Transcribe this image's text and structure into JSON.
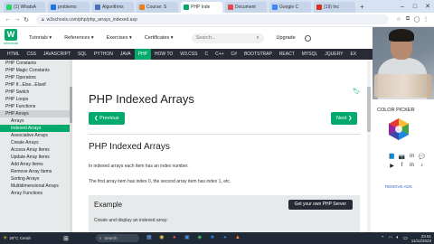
{
  "browser": {
    "tabs": [
      {
        "label": "(1) WhatsA",
        "color": "#25d366"
      },
      {
        "label": "problems",
        "color": "#1a73e8"
      },
      {
        "label": "Algorithms",
        "color": "#4b6fbf"
      },
      {
        "label": "Course: S",
        "color": "#e67e22"
      },
      {
        "label": "PHP Inde",
        "color": "#04aa6d",
        "active": true
      },
      {
        "label": "Document",
        "color": "#e14b4b"
      },
      {
        "label": "Google C",
        "color": "#4285f4"
      },
      {
        "label": "(19) Inc",
        "color": "#d93025"
      }
    ],
    "newtab": "+",
    "url": "w3schools.com/php/php_arrays_indexed.asp",
    "win_min": "–",
    "win_max": "□",
    "win_close": "✕"
  },
  "header": {
    "logo_letter": "W",
    "logo_text": "w3schools",
    "menu": [
      "Tutorials ▾",
      "References ▾",
      "Exercises ▾",
      "Certificates ▾"
    ],
    "search_placeholder": "Search...",
    "upgrade": "Upgrade"
  },
  "langnav": {
    "items": [
      "HTML",
      "CSS",
      "JAVASCRIPT",
      "SQL",
      "PYTHON",
      "JAVA",
      "PHP",
      "HOW TO",
      "W3.CSS",
      "C",
      "C++",
      "C#",
      "BOOTSTRAP",
      "REACT",
      "MYSQL",
      "JQUERY",
      "EX"
    ],
    "active_index": 6
  },
  "sidebar": {
    "items": [
      {
        "label": "PHP Constants",
        "kind": "item"
      },
      {
        "label": "PHP Magic Constants",
        "kind": "item"
      },
      {
        "label": "PHP Operators",
        "kind": "item"
      },
      {
        "label": "PHP If...Else...Elseif",
        "kind": "item"
      },
      {
        "label": "PHP Switch",
        "kind": "item"
      },
      {
        "label": "PHP Loops",
        "kind": "item"
      },
      {
        "label": "PHP Functions",
        "kind": "item"
      },
      {
        "label": "PHP Arrays",
        "kind": "head"
      },
      {
        "label": "Arrays",
        "kind": "sub"
      },
      {
        "label": "Indexed Arrays",
        "kind": "active"
      },
      {
        "label": "Associative Arrays",
        "kind": "sub"
      },
      {
        "label": "Create Arrays",
        "kind": "sub"
      },
      {
        "label": "Access Array Items",
        "kind": "sub"
      },
      {
        "label": "Update Array Items",
        "kind": "sub"
      },
      {
        "label": "Add Array Items",
        "kind": "sub"
      },
      {
        "label": "Remove Array Items",
        "kind": "sub"
      },
      {
        "label": "Sorting Arrays",
        "kind": "sub"
      },
      {
        "label": "Multidimensional Arrays",
        "kind": "sub"
      },
      {
        "label": "Array Functions",
        "kind": "sub"
      }
    ]
  },
  "main": {
    "title": "PHP Indexed Arrays",
    "prev": "❮ Previous",
    "next": "Next ❯",
    "section_title": "PHP Indexed Arrays",
    "para1": "In indexed arrays each item has an index number.",
    "para2": "The first array item has index 0, the second array item has index 1, etc.",
    "example_title": "Example",
    "example_desc": "Create and display an indexed array:",
    "get_server": "Get your own PHP Server"
  },
  "right": {
    "color_picker": "COLOR PICKER",
    "social": [
      "📘",
      "📷",
      "in",
      "💬",
      "▶",
      "f",
      "in",
      "♪"
    ],
    "remove_ads": "REMOVE ADS"
  },
  "taskbar": {
    "weather_temp": "29°C",
    "weather_desc": "Cerah",
    "search": "Search",
    "apps": [
      {
        "glyph": "▦",
        "color": "#6aa3f0"
      },
      {
        "glyph": "◉",
        "color": "#f2c94c"
      },
      {
        "glyph": "●",
        "color": "#e55353"
      },
      {
        "glyph": "▣",
        "color": "#4a90e2"
      },
      {
        "glyph": "◆",
        "color": "#34a853"
      },
      {
        "glyph": "■",
        "color": "#2b7cd3"
      },
      {
        "glyph": "◕",
        "color": "#4285f4"
      },
      {
        "glyph": "▲",
        "color": "#ff8f3f"
      }
    ],
    "time": "23.51",
    "date": "11/12/2023"
  }
}
